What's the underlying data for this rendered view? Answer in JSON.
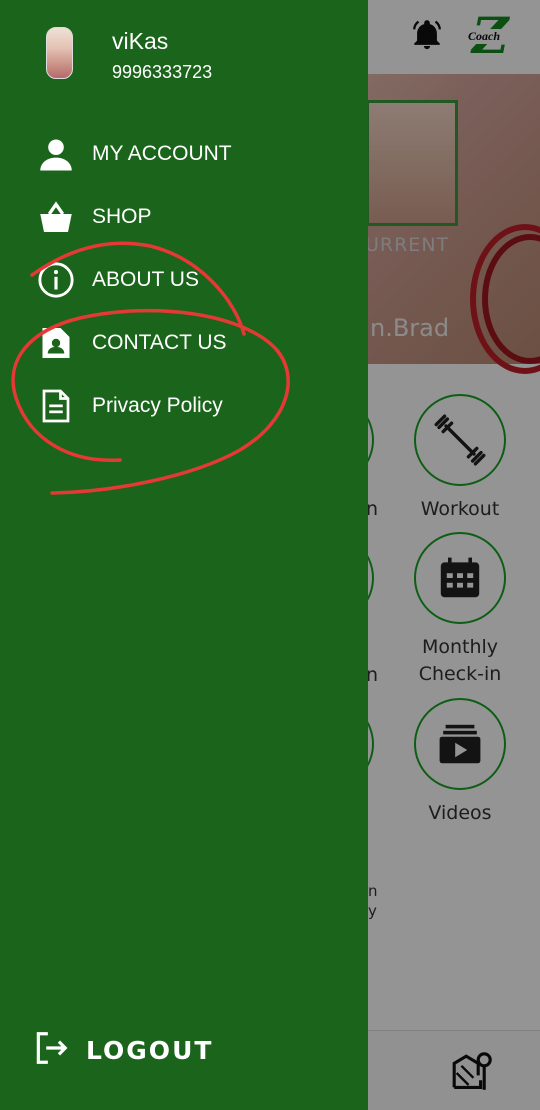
{
  "drawer": {
    "user": {
      "name": "viKas",
      "phone": "9996333723"
    },
    "menu": [
      {
        "label": "MY ACCOUNT",
        "icon": "person-icon"
      },
      {
        "label": "SHOP",
        "icon": "basket-icon"
      },
      {
        "label": "ABOUT US",
        "icon": "info-icon"
      },
      {
        "label": "CONTACT US",
        "icon": "contact-card-icon"
      },
      {
        "label": "Privacy Policy",
        "icon": "document-icon"
      }
    ],
    "logout_label": "LOGOUT",
    "bg_color": "#1b641b"
  },
  "background": {
    "logo_text": "Coach",
    "banner_current": "URRENT",
    "banner_name": "n.Brad",
    "tiles": [
      {
        "label": "Workout"
      },
      {
        "label": "Monthly Check-in",
        "line1": "Monthly",
        "line2": "Check-in"
      },
      {
        "label": "Videos"
      }
    ],
    "partial_text": [
      "n",
      "n",
      "n",
      "y"
    ],
    "accent_color": "#17a324"
  },
  "annotation": {
    "color": "#e53935"
  }
}
